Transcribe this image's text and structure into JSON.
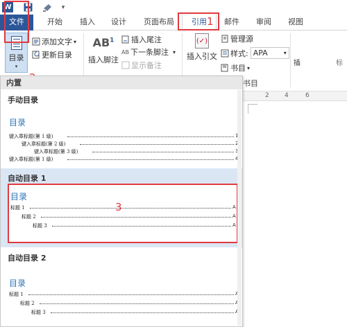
{
  "quick_access": {
    "app_icon": "W",
    "save_icon": "save-icon",
    "undo_icon": "undo-icon",
    "more": "▾"
  },
  "tabs": {
    "file": "文件",
    "home": "开始",
    "insert": "插入",
    "design": "设计",
    "layout": "页面布局",
    "references": "引用",
    "mailings": "邮件",
    "review": "审阅",
    "view": "视图"
  },
  "annotations": {
    "step1": "1",
    "step2": "2",
    "step3": "3"
  },
  "ribbon": {
    "toc": {
      "label": "目录",
      "arrow": "▾"
    },
    "add_text": "添加文字",
    "update_toc": "更新目录",
    "insert_footnote": "插入脚注",
    "footnote_icon_text": "AB",
    "footnote_sup": "1",
    "insert_endnote": "插入尾注",
    "next_footnote": "下一条脚注",
    "show_notes": "显示备注",
    "insert_citation": "插入引文",
    "manage_sources": "管理源",
    "style_label": "样式:",
    "style_value": "APA",
    "bibliography": "书目",
    "insert_cut": "插",
    "mark_cut": "标"
  },
  "document": {
    "group_label": "书目",
    "ruler_numbers": [
      "2",
      "4",
      "6"
    ]
  },
  "dropdown": {
    "builtin_header": "内置",
    "manual": {
      "title": "手动目录",
      "heading": "目录",
      "entries": [
        {
          "text": "键入章标题(第 1 级)",
          "page": "1"
        },
        {
          "text": "键入章标题(第 2 级)",
          "page": "2"
        },
        {
          "text": "键入章标题(第 3 级)",
          "page": "3"
        },
        {
          "text": "键入章标题(第 1 级)",
          "page": "4"
        }
      ]
    },
    "auto1": {
      "title": "自动目录 1",
      "heading": "目录",
      "entries": [
        {
          "text": "标题 1",
          "page": "A"
        },
        {
          "text": "标题 2",
          "page": "A"
        },
        {
          "text": "标题 3",
          "page": "A"
        }
      ]
    },
    "auto2": {
      "title": "自动目录 2",
      "heading": "目录",
      "entries": [
        {
          "text": "标题 1",
          "page": "A"
        },
        {
          "text": "标题 2",
          "page": "A"
        },
        {
          "text": "标题 3",
          "page": "A"
        }
      ]
    }
  },
  "colors": {
    "accent": "#2b579a",
    "highlight": "#e0393e",
    "toc_heading": "#2e74b5"
  }
}
